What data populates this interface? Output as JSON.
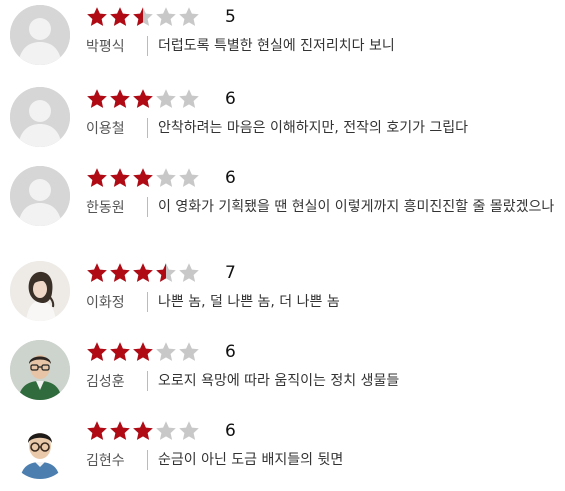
{
  "rating_max": 10,
  "colors": {
    "star_filled": "#b00a15",
    "star_empty": "#c8c8c8"
  },
  "reviews": [
    {
      "reviewer": "박평식",
      "score": "5",
      "rating": 5,
      "comment": "더럽도록 특별한 현실에 진저리치다 보니",
      "avatar": "default-silhouette"
    },
    {
      "reviewer": "이용철",
      "score": "6",
      "rating": 6,
      "comment": "안착하려는 마음은 이해하지만, 전작의 호기가 그립다",
      "avatar": "default-silhouette"
    },
    {
      "reviewer": "한동원",
      "score": "6",
      "rating": 6,
      "comment": "이 영화가 기획됐을 땐 현실이 이렇게까지 흥미진진할 줄 몰랐겠으나",
      "avatar": "default-silhouette"
    },
    {
      "reviewer": "이화정",
      "score": "7",
      "rating": 7,
      "comment": "나쁜 놈, 덜 나쁜 놈, 더 나쁜 놈",
      "avatar": "photo"
    },
    {
      "reviewer": "김성훈",
      "score": "6",
      "rating": 6,
      "comment": "오로지 욕망에 따라 움직이는 정치 생물들",
      "avatar": "photo"
    },
    {
      "reviewer": "김현수",
      "score": "6",
      "rating": 6,
      "comment": "순금이 아닌 도금 배지들의 뒷면",
      "avatar": "photo"
    }
  ]
}
